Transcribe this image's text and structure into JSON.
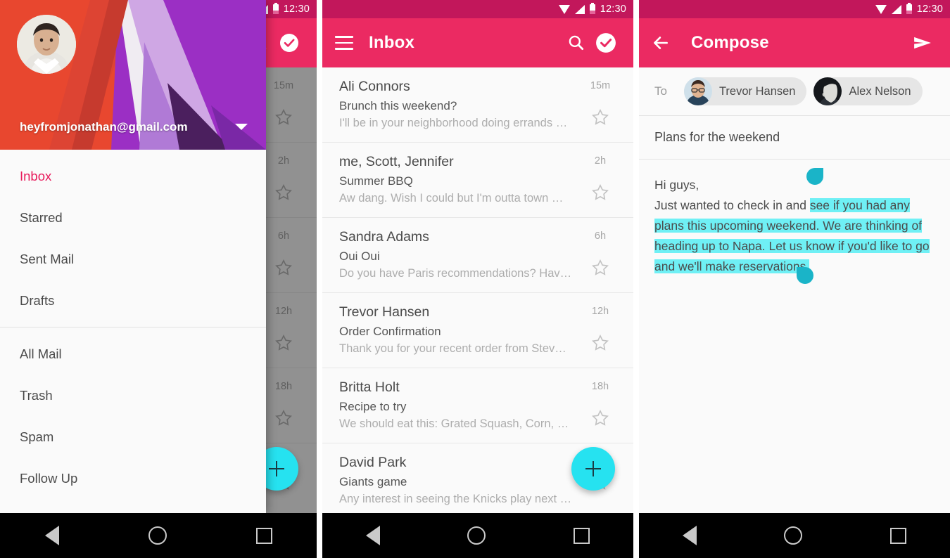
{
  "status_bar": {
    "time": "12:30",
    "icons": [
      "wifi-icon",
      "signal-icon",
      "battery-icon"
    ]
  },
  "colors": {
    "status_bar": "#C2175B",
    "app_bar": "#EB2A62",
    "accent_pink": "#E8185A",
    "fab_cyan": "#26E2F0",
    "selection_cyan": "#6FF0F5",
    "handle_teal": "#1AB4C8"
  },
  "drawer": {
    "account_email": "heyfromjonathan@gmail.com",
    "caret": "chevron-down-icon",
    "items": [
      {
        "label": "Inbox",
        "active": true
      },
      {
        "label": "Starred",
        "active": false
      },
      {
        "label": "Sent Mail",
        "active": false
      },
      {
        "label": "Drafts",
        "active": false
      }
    ],
    "items_secondary": [
      {
        "label": "All Mail",
        "active": false
      },
      {
        "label": "Trash",
        "active": false
      },
      {
        "label": "Spam",
        "active": false
      },
      {
        "label": "Follow Up",
        "active": false
      }
    ]
  },
  "inbox": {
    "title": "Inbox",
    "menu_icon": "hamburger-menu-icon",
    "search_icon": "search-icon",
    "done_icon": "check-circle-icon",
    "fab_icon": "plus-icon",
    "emails": [
      {
        "sender": "Ali Connors",
        "subject": "Brunch this weekend?",
        "snippet": "I'll be in your neighborhood doing errands …",
        "time": "15m"
      },
      {
        "sender": "me, Scott, Jennifer",
        "subject": "Summer BBQ",
        "snippet": "Aw dang. Wish I could but I'm outta town …",
        "time": "2h"
      },
      {
        "sender": "Sandra Adams",
        "subject": "Oui Oui",
        "snippet": "Do you have Paris recommendations? Hav…",
        "time": "6h"
      },
      {
        "sender": "Trevor Hansen",
        "subject": "Order Confirmation",
        "snippet": "Thank you for your recent order from Stev…",
        "time": "12h"
      },
      {
        "sender": "Britta Holt",
        "subject": "Recipe to try",
        "snippet": "We should eat this: Grated Squash, Corn, …",
        "time": "18h"
      },
      {
        "sender": "David Park",
        "subject": "Giants game",
        "snippet": "Any interest in seeing the Knicks play next …",
        "time": ""
      }
    ]
  },
  "compose": {
    "title": "Compose",
    "back_icon": "arrow-back-icon",
    "send_icon": "send-icon",
    "to_label": "To",
    "recipients": [
      {
        "name": "Trevor Hansen"
      },
      {
        "name": "Alex Nelson"
      }
    ],
    "subject": "Plans for the weekend",
    "body_lines": [
      {
        "plain": "Hi guys,",
        "highlighted": ""
      },
      {
        "plain": "Just wanted to check in and ",
        "highlighted": "see if you had any"
      },
      {
        "plain": "",
        "highlighted": "plans this upcoming weekend. We are thinking of"
      },
      {
        "plain": "",
        "highlighted": "heading up to Napa. Let us know if you'd like to go"
      },
      {
        "plain": "",
        "highlighted": "and we'll make reservations."
      }
    ]
  },
  "nav_bar": {
    "back": "back-triangle-icon",
    "home": "home-circle-icon",
    "recents": "recents-square-icon"
  }
}
